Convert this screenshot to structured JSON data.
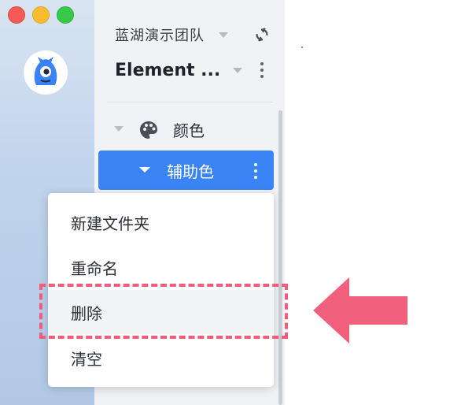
{
  "window": {
    "controls": [
      "close",
      "minimize",
      "maximize"
    ],
    "colors": {
      "close": "#f55a56",
      "minimize": "#f9bc2f",
      "maximize": "#38c94a"
    }
  },
  "app": {
    "logo_icon": "blue-monster-icon"
  },
  "team": {
    "name": "蓝湖演示团队"
  },
  "project": {
    "name": "Element ..."
  },
  "tree": {
    "folder": {
      "label": "颜色",
      "icon": "palette-icon"
    },
    "selected": {
      "label": "辅助色"
    }
  },
  "context_menu": {
    "items": [
      {
        "label": "新建文件夹"
      },
      {
        "label": "重命名"
      },
      {
        "label": "删除"
      },
      {
        "label": "清空"
      }
    ],
    "highlighted_index": 2
  },
  "annotation": {
    "color": "#ef5d7b"
  },
  "colors": {
    "accent": "#3a84f5",
    "panel": "#f0f2f5"
  }
}
